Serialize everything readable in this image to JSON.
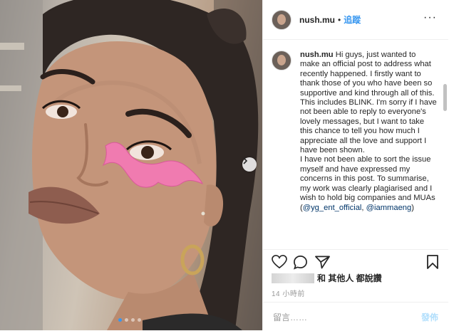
{
  "post": {
    "username": "nush.mu",
    "separator": "•",
    "follow_label": "追蹤",
    "more_label": "···",
    "caption_username": "nush.mu",
    "caption_p1": "Hi guys, just wanted to make an official post to address what recently happened. I firstly want to thank those of you who have been so supportive and kind through all of this. This includes BLINK. I'm sorry if I have not been able to reply to everyone's lovely messages, but I want to take this chance to tell you how much I appreciate all the love and support I have been shown.",
    "caption_p2": "I have not been able to sort the issue myself and have expressed my concerns in this post. To summarise, my work was clearly plagiarised and I wish to hold big companies and MUAs",
    "mention_1": "@yg_ent_official",
    "mention_sep": ", ",
    "mention_2": "@iammaeng",
    "mention_close": ")",
    "mention_open": "("
  },
  "actions": {
    "likes_suffix": "和 其他人 都說讚",
    "time_ago": "14 小時前",
    "comment_placeholder": "留言……",
    "post_label": "發佈"
  },
  "carousel": {
    "slides": 4,
    "active_index": 0
  },
  "colors": {
    "accent": "#3897f0",
    "text": "#262626",
    "muted": "#999999",
    "border": "#efefef",
    "post_disabled": "#b2dffc",
    "mention": "#003569"
  },
  "icons": [
    "chevron-right-icon",
    "more-icon",
    "heart-icon",
    "comment-icon",
    "share-icon",
    "bookmark-icon"
  ]
}
